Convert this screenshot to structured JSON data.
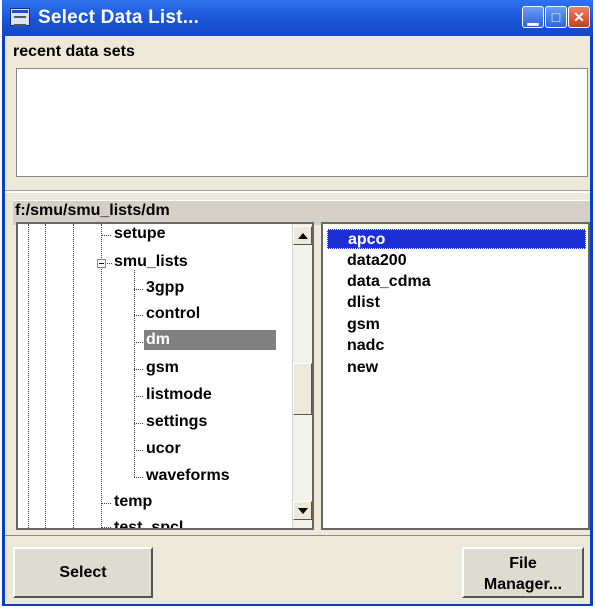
{
  "window": {
    "title": "Select Data List..."
  },
  "recent": {
    "label": "recent data sets"
  },
  "path": "f:/smu/smu_lists/dm",
  "tree": {
    "items": [
      {
        "label": "setupe"
      },
      {
        "label": "smu_lists"
      },
      {
        "label": "3gpp"
      },
      {
        "label": "control"
      },
      {
        "label": "dm"
      },
      {
        "label": "gsm"
      },
      {
        "label": "listmode"
      },
      {
        "label": "settings"
      },
      {
        "label": "ucor"
      },
      {
        "label": "waveforms"
      },
      {
        "label": "temp"
      },
      {
        "label": "test_spcl"
      }
    ],
    "selected": "dm"
  },
  "files": {
    "items": [
      "apco",
      "data200",
      "data_cdma",
      "dlist",
      "gsm",
      "nadc",
      "new"
    ],
    "selected": "apco"
  },
  "buttons": {
    "select": "Select",
    "file_manager_line1": "File",
    "file_manager_line2": "Manager..."
  },
  "colors": {
    "titlebar": "#1a55d6",
    "selection_file": "#1c2fd6",
    "selection_tree": "#808080",
    "window_bg": "#ece9d8"
  }
}
